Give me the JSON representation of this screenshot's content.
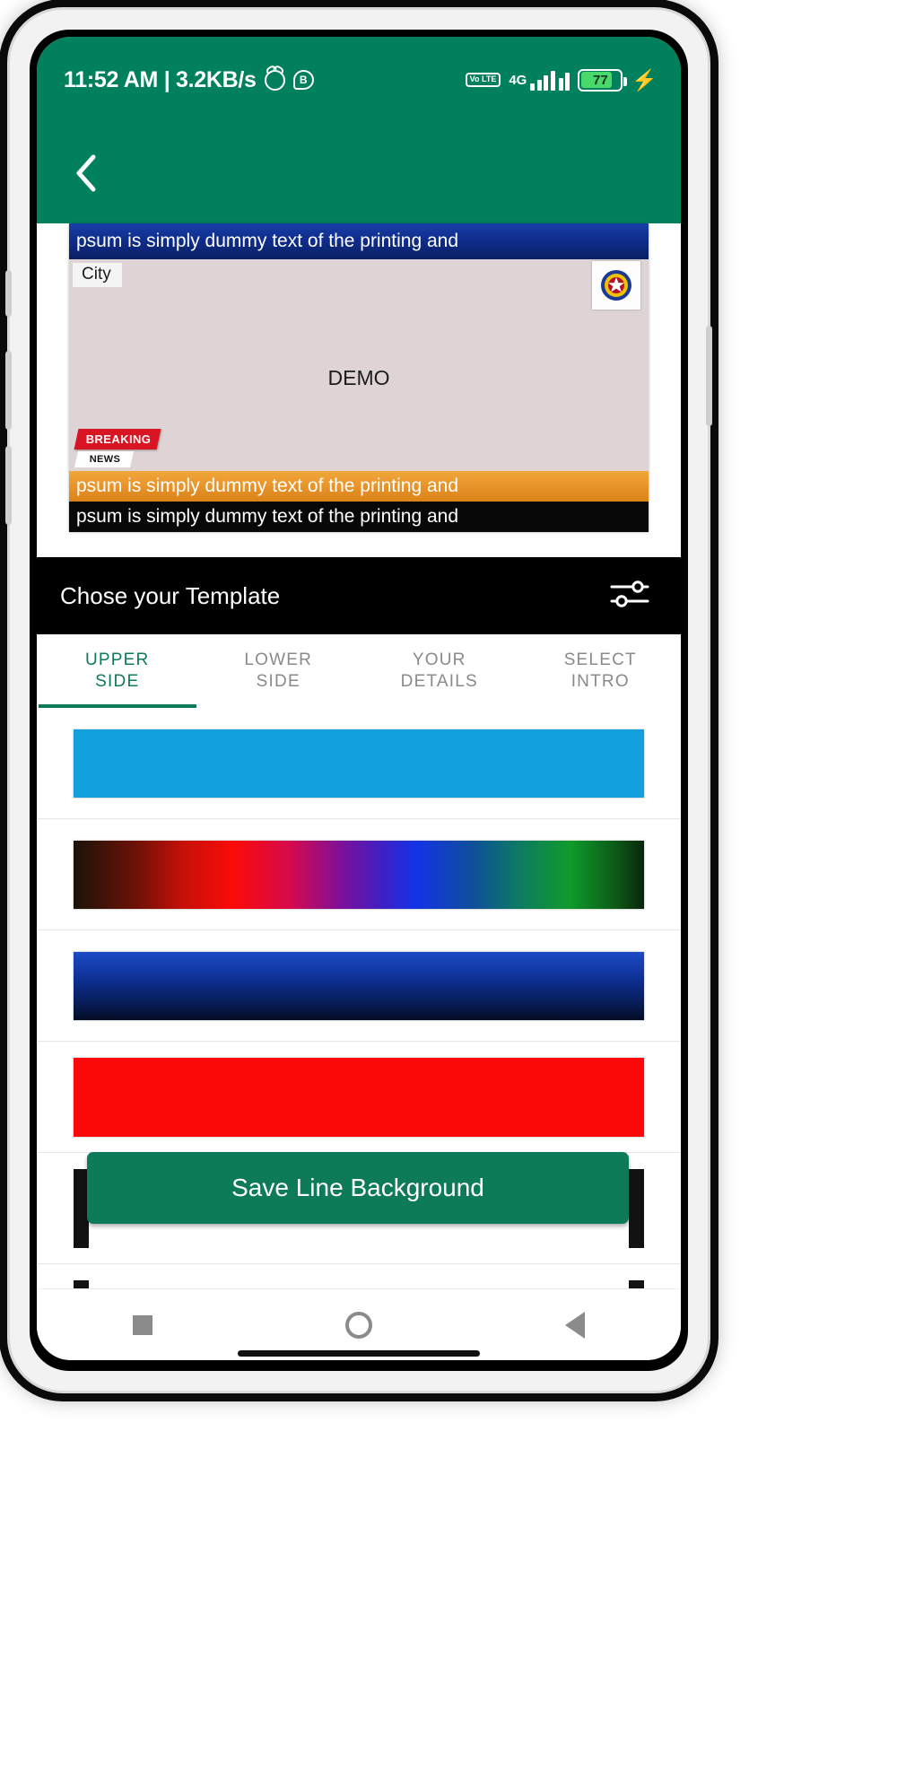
{
  "status_bar": {
    "clock": "11:52 AM | 3.2KB/s",
    "alarm_icon": "alarm-clock-icon",
    "bubble_icon_label": "B",
    "volte_line1": "Vo",
    "volte_line2": "LTE",
    "network_type": "4G",
    "battery_percent": "77",
    "charging_glyph": "⚡",
    "background_color": "#00805c"
  },
  "app_bar": {
    "back_icon": "chevron-left-icon",
    "background_color": "#00805c"
  },
  "preview": {
    "headline_text": "psum is simply dummy text of the printing and",
    "city_label": "City",
    "center_label": "DEMO",
    "breaking_top": "BREAKING",
    "breaking_bottom": "NEWS",
    "ticker_orange_text": "psum is simply dummy text of the printing and",
    "ticker_black_text": "psum is simply dummy text of the printing and",
    "logo_name": "channel-emblem-icon",
    "headline_color": "#0f2d8c",
    "ticker_orange_color": "#e8942a",
    "ticker_black_color": "#080808",
    "card_background": "#ded4d6"
  },
  "template_bar": {
    "title": "Chose your Template",
    "settings_icon": "sliders-settings-icon",
    "background_color": "#000000"
  },
  "tabs": [
    {
      "line1": "UPPER",
      "line2": "SIDE",
      "active": true
    },
    {
      "line1": "LOWER",
      "line2": "SIDE",
      "active": false
    },
    {
      "line1": "YOUR",
      "line2": "DETAILS",
      "active": false
    },
    {
      "line1": "SELECT",
      "line2": "INTRO",
      "active": false
    }
  ],
  "tab_accent_color": "#0d7a5a",
  "swatches": [
    {
      "name": "solid-sky-blue",
      "type": "solid",
      "color": "#12a1de"
    },
    {
      "name": "rainbow-spectrum",
      "type": "gradient",
      "color": "#c41008"
    },
    {
      "name": "navy-blue-gradient",
      "type": "gradient",
      "color": "#0e2f94"
    },
    {
      "name": "solid-red",
      "type": "solid",
      "color": "#fb0808"
    },
    {
      "name": "white-with-black-side-bars",
      "type": "bars",
      "color": "#ffffff"
    },
    {
      "name": "white-with-black-side-bars-2",
      "type": "bars",
      "color": "#ffffff"
    }
  ],
  "save_button": {
    "label": "Save Line Background",
    "color": "#0d7a5a"
  },
  "nav_bar": {
    "recent_icon": "square-recents-icon",
    "home_icon": "circle-home-icon",
    "back_icon": "triangle-back-icon"
  }
}
